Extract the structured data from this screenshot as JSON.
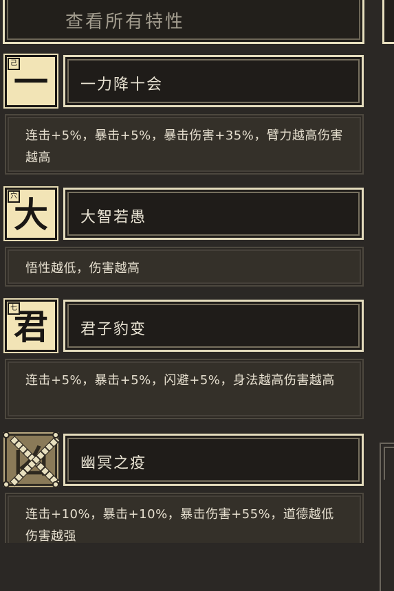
{
  "header": {
    "title": "查看所有特性"
  },
  "traits": [
    {
      "icon_char": "一",
      "badge": "己",
      "cursed": false,
      "name": "一力降十会",
      "desc": "连击+5%，暴击+5%，暴击伤害+35%，臂力越高伤害越高"
    },
    {
      "icon_char": "大",
      "badge": "穴",
      "cursed": false,
      "name": "大智若愚",
      "desc": "悟性越低，伤害越高"
    },
    {
      "icon_char": "君",
      "badge": "七",
      "cursed": false,
      "name": "君子豹变",
      "desc": "连击+5%，暴击+5%，闪避+5%，身法越高伤害越高"
    },
    {
      "icon_char": "凶",
      "badge": "",
      "cursed": true,
      "name": "幽冥之疫",
      "desc": "连击+10%，暴击+10%，暴击伤害+55%，道德越低伤害越强"
    }
  ]
}
